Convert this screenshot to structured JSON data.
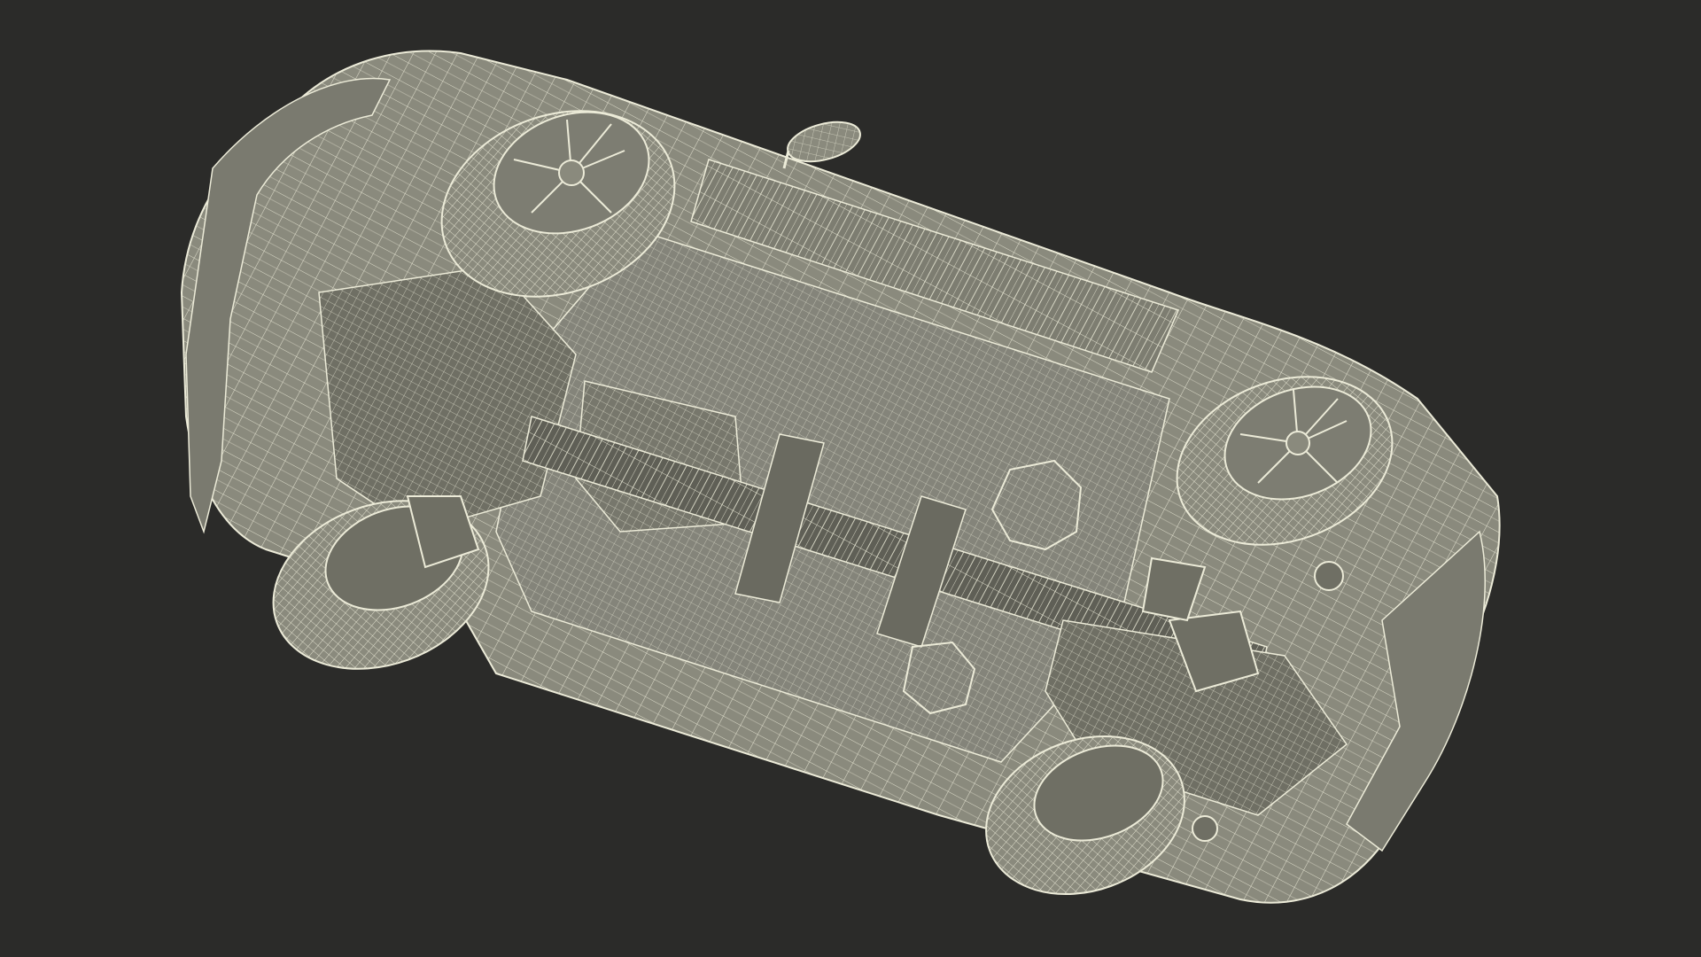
{
  "scene": {
    "subject": "car-underside-wireframe-render",
    "colors": {
      "background": "#2b2b29",
      "surface": "#8a8a7d",
      "surface_dark": "#6f6f64",
      "surface_shadow": "#55554c",
      "wire": "#ecebd8"
    }
  }
}
